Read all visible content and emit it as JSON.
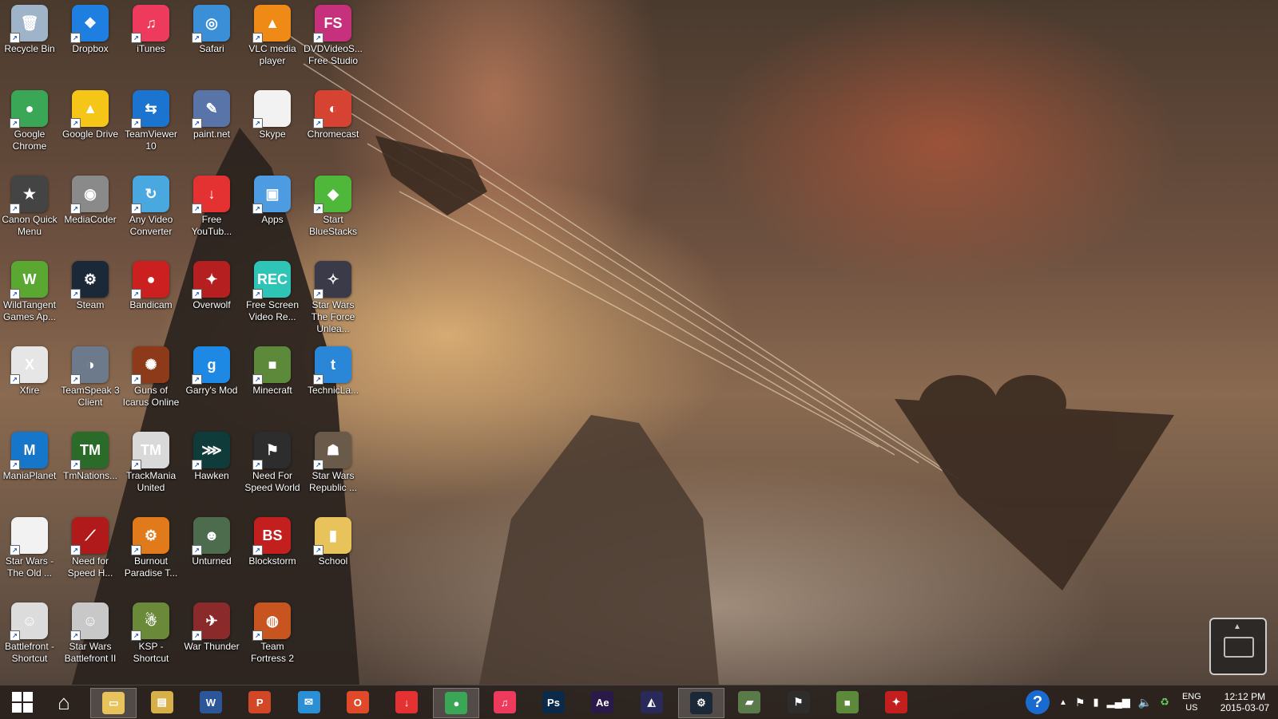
{
  "desktop_icons": [
    {
      "label": "Recycle Bin",
      "icon": "recycle-bin-icon",
      "color": "#9fb4c8",
      "glyph": "🗑"
    },
    {
      "label": "Dropbox",
      "icon": "dropbox-icon",
      "color": "#1f7fe0",
      "glyph": "❖"
    },
    {
      "label": "iTunes",
      "icon": "itunes-icon",
      "color": "#ee3a5c",
      "glyph": "♫"
    },
    {
      "label": "Safari",
      "icon": "safari-icon",
      "color": "#3a8fd6",
      "glyph": "◎"
    },
    {
      "label": "VLC media player",
      "icon": "vlc-icon",
      "color": "#f08a16",
      "glyph": "▲"
    },
    {
      "label": "DVDVideoS... Free Studio",
      "icon": "free-studio-icon",
      "color": "#c6307c",
      "glyph": "FS"
    },
    {
      "label": "Google Chrome",
      "icon": "chrome-icon",
      "color": "#3aa757",
      "glyph": "●"
    },
    {
      "label": "Google Drive",
      "icon": "google-drive-icon",
      "color": "#f5c518",
      "glyph": "▲"
    },
    {
      "label": "TeamViewer 10",
      "icon": "teamviewer-icon",
      "color": "#1b75d0",
      "glyph": "⇆"
    },
    {
      "label": "paint.net",
      "icon": "paintnet-icon",
      "color": "#5874a8",
      "glyph": "✎"
    },
    {
      "label": "Skype",
      "icon": "skype-doc-icon",
      "color": "#f2f2f2",
      "glyph": ""
    },
    {
      "label": "Chromecast",
      "icon": "chromecast-icon",
      "color": "#d74332",
      "glyph": "◐"
    },
    {
      "label": "Canon Quick Menu",
      "icon": "canon-quick-menu-icon",
      "color": "#444",
      "glyph": "★"
    },
    {
      "label": "MediaCoder",
      "icon": "mediacoder-icon",
      "color": "#8a8a8a",
      "glyph": "◉"
    },
    {
      "label": "Any Video Converter",
      "icon": "any-video-converter-icon",
      "color": "#49a8e0",
      "glyph": "↻"
    },
    {
      "label": "Free YouTub...",
      "icon": "free-youtube-download-icon",
      "color": "#e43232",
      "glyph": "↓"
    },
    {
      "label": "Apps",
      "icon": "apps-icon",
      "color": "#4d9be0",
      "glyph": "▣"
    },
    {
      "label": "Start BlueStacks",
      "icon": "bluestacks-icon",
      "color": "#4fb83a",
      "glyph": "◆"
    },
    {
      "label": "WildTangent Games Ap...",
      "icon": "wildtangent-icon",
      "color": "#5aa832",
      "glyph": "W"
    },
    {
      "label": "Steam",
      "icon": "steam-icon",
      "color": "#1b2838",
      "glyph": "⚙"
    },
    {
      "label": "Bandicam",
      "icon": "bandicam-icon",
      "color": "#cc1f1f",
      "glyph": "●"
    },
    {
      "label": "Overwolf",
      "icon": "overwolf-icon",
      "color": "#b51f1f",
      "glyph": "✦"
    },
    {
      "label": "Free Screen Video Re...",
      "icon": "free-screen-recorder-icon",
      "color": "#2ec4b6",
      "glyph": "REC"
    },
    {
      "label": "Star Wars The Force Unlea...",
      "icon": "star-wars-force-unleashed-icon",
      "color": "#3a3a48",
      "glyph": "✧"
    },
    {
      "label": "Xfire",
      "icon": "xfire-icon",
      "color": "#e6e6e6",
      "glyph": "X"
    },
    {
      "label": "TeamSpeak 3 Client",
      "icon": "teamspeak-icon",
      "color": "#6c7a8c",
      "glyph": "◑"
    },
    {
      "label": "Guns of Icarus Online",
      "icon": "guns-of-icarus-icon",
      "color": "#8c3a1a",
      "glyph": "✺"
    },
    {
      "label": "Garry's Mod",
      "icon": "garrys-mod-icon",
      "color": "#1e88e5",
      "glyph": "g"
    },
    {
      "label": "Minecraft",
      "icon": "minecraft-icon",
      "color": "#5c8a3a",
      "glyph": "■"
    },
    {
      "label": "TechnicLa...",
      "icon": "technic-launcher-icon",
      "color": "#2a86d6",
      "glyph": "t"
    },
    {
      "label": "ManiaPlanet",
      "icon": "maniaplanet-icon",
      "color": "#1676c9",
      "glyph": "M"
    },
    {
      "label": "TmNations...",
      "icon": "tmnations-icon",
      "color": "#2a6b2a",
      "glyph": "TM"
    },
    {
      "label": "TrackMania United",
      "icon": "trackmania-united-icon",
      "color": "#d9d9d9",
      "glyph": "TM"
    },
    {
      "label": "Hawken",
      "icon": "hawken-icon",
      "color": "#0f3b3a",
      "glyph": "⋙"
    },
    {
      "label": "Need For Speed World",
      "icon": "nfs-world-icon",
      "color": "#2d2d2d",
      "glyph": "⚑"
    },
    {
      "label": "Star Wars Republic ...",
      "icon": "star-wars-republic-icon",
      "color": "#6a5a4a",
      "glyph": "☗"
    },
    {
      "label": "Star Wars - The Old ...",
      "icon": "star-wars-old-republic-icon",
      "color": "#f2f2f2",
      "glyph": ""
    },
    {
      "label": "Need for Speed H...",
      "icon": "nfs-hot-pursuit-icon",
      "color": "#b01a1a",
      "glyph": "⟋"
    },
    {
      "label": "Burnout Paradise T...",
      "icon": "burnout-paradise-icon",
      "color": "#e07a1a",
      "glyph": "⚙"
    },
    {
      "label": "Unturned",
      "icon": "unturned-icon",
      "color": "#4d6b4d",
      "glyph": "☻"
    },
    {
      "label": "Blockstorm",
      "icon": "blockstorm-icon",
      "color": "#c41f1f",
      "glyph": "BS"
    },
    {
      "label": "School",
      "icon": "school-folder-icon",
      "color": "#e8c25a",
      "glyph": "▮"
    },
    {
      "label": "Battlefront - Shortcut",
      "icon": "battlefront-icon",
      "color": "#dcdcdc",
      "glyph": "☺"
    },
    {
      "label": "Star Wars Battlefront II",
      "icon": "star-wars-battlefront-2-icon",
      "color": "#c8c8c8",
      "glyph": "☺"
    },
    {
      "label": "KSP - Shortcut",
      "icon": "ksp-icon",
      "color": "#6a8a3a",
      "glyph": "☃"
    },
    {
      "label": "War Thunder",
      "icon": "war-thunder-icon",
      "color": "#8a2a2a",
      "glyph": "✈"
    },
    {
      "label": "Team Fortress 2",
      "icon": "team-fortress-2-icon",
      "color": "#c8551f",
      "glyph": "◍"
    }
  ],
  "taskbar": {
    "start_icon": "windows-logo-icon",
    "items": [
      {
        "name": "home-button",
        "icon": "home-icon",
        "color": "#ffffff",
        "glyph": "⌂",
        "active": false
      },
      {
        "name": "file-explorer",
        "icon": "file-explorer-icon",
        "color": "#e8c25a",
        "glyph": "▭",
        "active": true
      },
      {
        "name": "folder",
        "icon": "folder-icon",
        "color": "#d8b04a",
        "glyph": "▤",
        "active": false
      },
      {
        "name": "word",
        "icon": "word-icon",
        "color": "#2b579a",
        "glyph": "W",
        "active": false
      },
      {
        "name": "powerpoint",
        "icon": "powerpoint-icon",
        "color": "#d24726",
        "glyph": "P",
        "active": false
      },
      {
        "name": "mail",
        "icon": "mail-icon",
        "color": "#2b8fd6",
        "glyph": "✉",
        "active": false
      },
      {
        "name": "office",
        "icon": "office-icon",
        "color": "#e04a2a",
        "glyph": "O",
        "active": false
      },
      {
        "name": "free-youtube",
        "icon": "download-icon",
        "color": "#e43232",
        "glyph": "↓",
        "active": false
      },
      {
        "name": "chrome",
        "icon": "chrome-icon",
        "color": "#3aa757",
        "glyph": "●",
        "active": true
      },
      {
        "name": "itunes",
        "icon": "itunes-icon",
        "color": "#ee3a5c",
        "glyph": "♫",
        "active": false
      },
      {
        "name": "photoshop",
        "icon": "photoshop-icon",
        "color": "#0b2a4a",
        "glyph": "Ps",
        "active": false
      },
      {
        "name": "after-effects",
        "icon": "after-effects-icon",
        "color": "#2a1a4a",
        "glyph": "Ae",
        "active": false
      },
      {
        "name": "premiere",
        "icon": "premiere-icon",
        "color": "#2a2a5a",
        "glyph": "◭",
        "active": false
      },
      {
        "name": "steam",
        "icon": "steam-icon",
        "color": "#1b2838",
        "glyph": "⚙",
        "active": true
      },
      {
        "name": "game-1",
        "icon": "racing-game-icon",
        "color": "#5a7a4a",
        "glyph": "▰",
        "active": false
      },
      {
        "name": "nfs-world",
        "icon": "nfs-world-icon",
        "color": "#2d2d2d",
        "glyph": "⚑",
        "active": false
      },
      {
        "name": "minecraft",
        "icon": "minecraft-icon",
        "color": "#5c8a3a",
        "glyph": "■",
        "active": false
      },
      {
        "name": "game-2",
        "icon": "game-launcher-icon",
        "color": "#c41f1f",
        "glyph": "✦",
        "active": false
      }
    ],
    "tray": {
      "help_icon": "help-icon",
      "language_line1": "ENG",
      "language_line2": "US",
      "time": "12:12 PM",
      "date": "2015-03-07"
    }
  }
}
